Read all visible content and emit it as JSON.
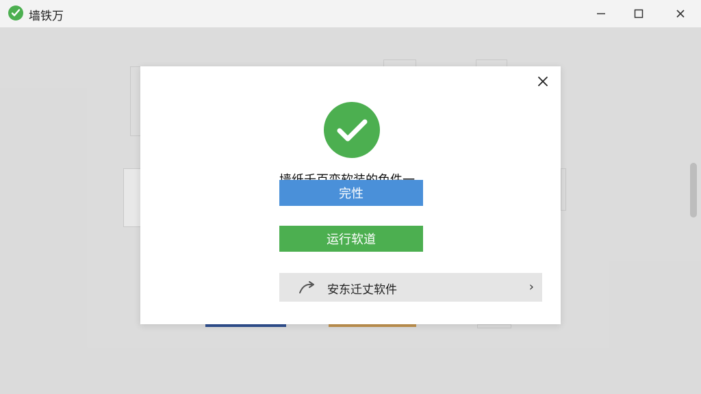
{
  "window": {
    "title": "墙铁万"
  },
  "dialog": {
    "headline": "墙纸千百变软装的色件一",
    "primary_button": "完性",
    "run_button": "运行软道",
    "install_row_label": "安东迁丈软件"
  },
  "icons": {
    "app": "check-circle-icon",
    "minimize": "minimize-icon",
    "maximize": "maximize-icon",
    "close": "close-icon",
    "dialog_close": "close-icon",
    "success": "check-circle-icon",
    "install": "arrow-icon",
    "chevron": "chevron-right-icon"
  },
  "colors": {
    "accent_green": "#4caf50",
    "accent_blue": "#4a90d9"
  }
}
